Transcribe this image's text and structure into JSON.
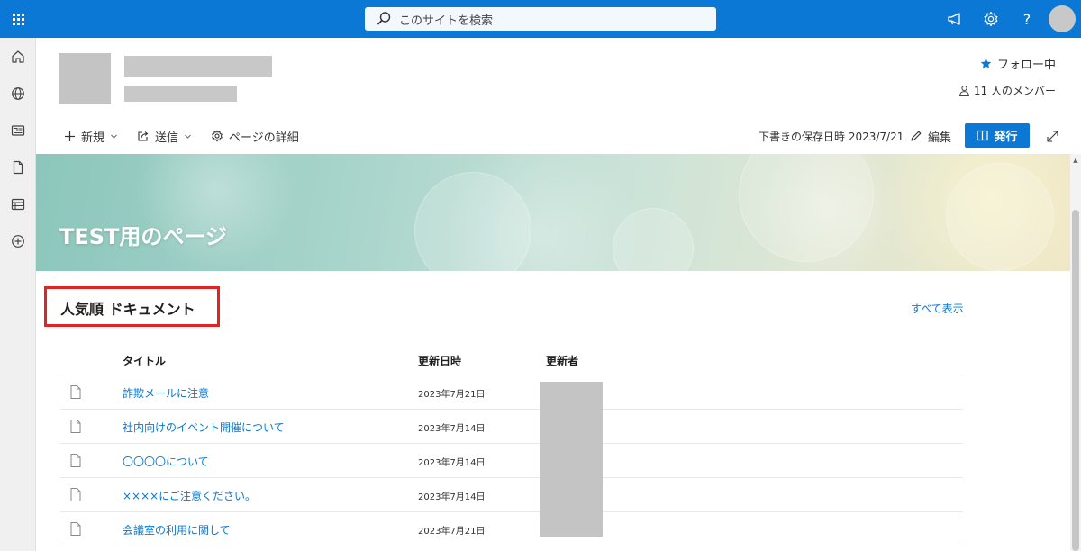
{
  "suite": {
    "search_placeholder": "このサイトを検索",
    "accent": "#0a78d4"
  },
  "header": {
    "follow_label": "フォロー中",
    "members_label": "11 人のメンバー"
  },
  "command_bar": {
    "new_label": "新規",
    "send_label": "送信",
    "page_details_label": "ページの詳細",
    "draft_saved_text": "下書きの保存日時 2023/7/21",
    "edit_label": "編集",
    "publish_label": "発行"
  },
  "hero": {
    "title": "TEST用のページ"
  },
  "popular_docs": {
    "title": "人気順 ドキュメント",
    "see_all_label": "すべて表示",
    "columns": {
      "title": "タイトル",
      "modified": "更新日時",
      "modified_by": "更新者"
    },
    "rows": [
      {
        "title": "詐欺メールに注意",
        "modified": "2023年7月21日"
      },
      {
        "title": "社内向けのイベント開催について",
        "modified": "2023年7月14日"
      },
      {
        "title": "〇〇〇〇について",
        "modified": "2023年7月14日"
      },
      {
        "title": "××××にご注意ください。",
        "modified": "2023年7月14日"
      },
      {
        "title": "会議室の利用に関して",
        "modified": "2023年7月21日"
      }
    ]
  }
}
